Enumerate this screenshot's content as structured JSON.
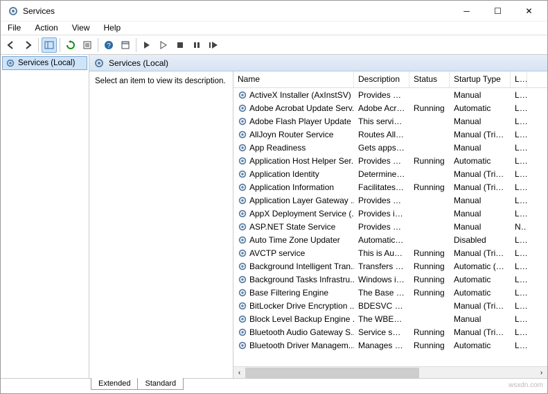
{
  "window": {
    "title": "Services"
  },
  "menubar": [
    "File",
    "Action",
    "View",
    "Help"
  ],
  "tree": {
    "root": "Services (Local)"
  },
  "main_header": "Services (Local)",
  "detail_prompt": "Select an item to view its description.",
  "columns": {
    "name": "Name",
    "description": "Description",
    "status": "Status",
    "startup": "Startup Type",
    "logon": "Lo"
  },
  "services": [
    {
      "name": "ActiveX Installer (AxInstSV)",
      "desc": "Provides Us...",
      "status": "",
      "startup": "Manual",
      "logon": "Lo"
    },
    {
      "name": "Adobe Acrobat Update Serv...",
      "desc": "Adobe Acro...",
      "status": "Running",
      "startup": "Automatic",
      "logon": "Lo"
    },
    {
      "name": "Adobe Flash Player Update ...",
      "desc": "This service ...",
      "status": "",
      "startup": "Manual",
      "logon": "Lo"
    },
    {
      "name": "AllJoyn Router Service",
      "desc": "Routes AllJo...",
      "status": "",
      "startup": "Manual (Trig...",
      "logon": "Lo"
    },
    {
      "name": "App Readiness",
      "desc": "Gets apps re...",
      "status": "",
      "startup": "Manual",
      "logon": "Lo"
    },
    {
      "name": "Application Host Helper Ser...",
      "desc": "Provides ad...",
      "status": "Running",
      "startup": "Automatic",
      "logon": "Lo"
    },
    {
      "name": "Application Identity",
      "desc": "Determines ...",
      "status": "",
      "startup": "Manual (Trig...",
      "logon": "Lo"
    },
    {
      "name": "Application Information",
      "desc": "Facilitates t...",
      "status": "Running",
      "startup": "Manual (Trig...",
      "logon": "Lo"
    },
    {
      "name": "Application Layer Gateway ...",
      "desc": "Provides su...",
      "status": "",
      "startup": "Manual",
      "logon": "Lo"
    },
    {
      "name": "AppX Deployment Service (...",
      "desc": "Provides inf...",
      "status": "",
      "startup": "Manual",
      "logon": "Lo"
    },
    {
      "name": "ASP.NET State Service",
      "desc": "Provides su...",
      "status": "",
      "startup": "Manual",
      "logon": "Ne"
    },
    {
      "name": "Auto Time Zone Updater",
      "desc": "Automatica...",
      "status": "",
      "startup": "Disabled",
      "logon": "Lo"
    },
    {
      "name": "AVCTP service",
      "desc": "This is Audi...",
      "status": "Running",
      "startup": "Manual (Trig...",
      "logon": "Lo"
    },
    {
      "name": "Background Intelligent Tran...",
      "desc": "Transfers fil...",
      "status": "Running",
      "startup": "Automatic (D...",
      "logon": "Lo"
    },
    {
      "name": "Background Tasks Infrastru...",
      "desc": "Windows in...",
      "status": "Running",
      "startup": "Automatic",
      "logon": "Lo"
    },
    {
      "name": "Base Filtering Engine",
      "desc": "The Base Fil...",
      "status": "Running",
      "startup": "Automatic",
      "logon": "Lo"
    },
    {
      "name": "BitLocker Drive Encryption ...",
      "desc": "BDESVC hos...",
      "status": "",
      "startup": "Manual (Trig...",
      "logon": "Lo"
    },
    {
      "name": "Block Level Backup Engine ...",
      "desc": "The WBENG...",
      "status": "",
      "startup": "Manual",
      "logon": "Lo"
    },
    {
      "name": "Bluetooth Audio Gateway S...",
      "desc": "Service sup...",
      "status": "Running",
      "startup": "Manual (Trig...",
      "logon": "Lo"
    },
    {
      "name": "Bluetooth Driver Managem...",
      "desc": "Manages BT...",
      "status": "Running",
      "startup": "Automatic",
      "logon": "Lo"
    }
  ],
  "tabs": {
    "extended": "Extended",
    "standard": "Standard"
  },
  "watermark": "wsxdn.com"
}
